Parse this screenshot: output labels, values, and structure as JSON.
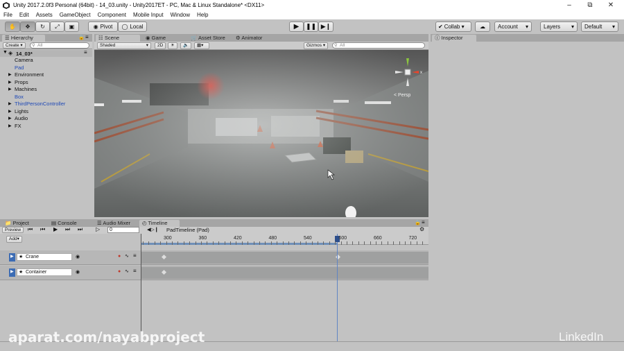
{
  "window": {
    "title": "Unity 2017.2.0f3 Personal (64bit) - 14_03.unity - Unity2017ET - PC, Mac & Linux Standalone* <DX11>"
  },
  "menu": [
    "File",
    "Edit",
    "Assets",
    "GameObject",
    "Component",
    "Mobile Input",
    "Window",
    "Help"
  ],
  "toolbar": {
    "pivot": "Pivot",
    "local": "Local",
    "collab": "Collab ▾",
    "account": "Account",
    "layers": "Layers",
    "layout": "Default"
  },
  "hierarchy": {
    "tab": "Hierarchy",
    "create": "Create ▾",
    "search_placeholder": "All",
    "scene": "14_03*",
    "items": [
      {
        "label": "Camera",
        "expandable": false,
        "blue": false
      },
      {
        "label": "Pad",
        "expandable": false,
        "blue": true
      },
      {
        "label": "Environment",
        "expandable": true,
        "blue": false
      },
      {
        "label": "Props",
        "expandable": true,
        "blue": false
      },
      {
        "label": "Machines",
        "expandable": true,
        "blue": false
      },
      {
        "label": "Box",
        "expandable": false,
        "blue": true
      },
      {
        "label": "ThirdPersonController",
        "expandable": true,
        "blue": true
      },
      {
        "label": "Lights",
        "expandable": true,
        "blue": false
      },
      {
        "label": "Audio",
        "expandable": true,
        "blue": false
      },
      {
        "label": "FX",
        "expandable": true,
        "blue": false
      }
    ]
  },
  "scene_tabs": [
    "Scene",
    "Game",
    "Asset Store",
    "Animator"
  ],
  "scene_toolbar": {
    "shading": "Shaded",
    "mode2d": "2D",
    "gizmos": "Gizmos ▾",
    "search_placeholder": "All"
  },
  "scene_view": {
    "persp_label": "< Persp"
  },
  "inspector": {
    "tab": "Inspector"
  },
  "bottom_tabs": [
    "Project",
    "Console",
    "Audio Mixer",
    "Timeline"
  ],
  "timeline": {
    "preview": "Preview",
    "frame": "0",
    "asset_name": "PadTimeline (Pad)",
    "add": "Add▾",
    "ticks": [
      "300",
      "360",
      "420",
      "480",
      "540",
      "600",
      "660",
      "720"
    ],
    "tracks": [
      {
        "label": "Crane"
      },
      {
        "label": "Container"
      }
    ]
  },
  "watermark": "aparat.com/nayabproject",
  "brand": "LinkedIn"
}
